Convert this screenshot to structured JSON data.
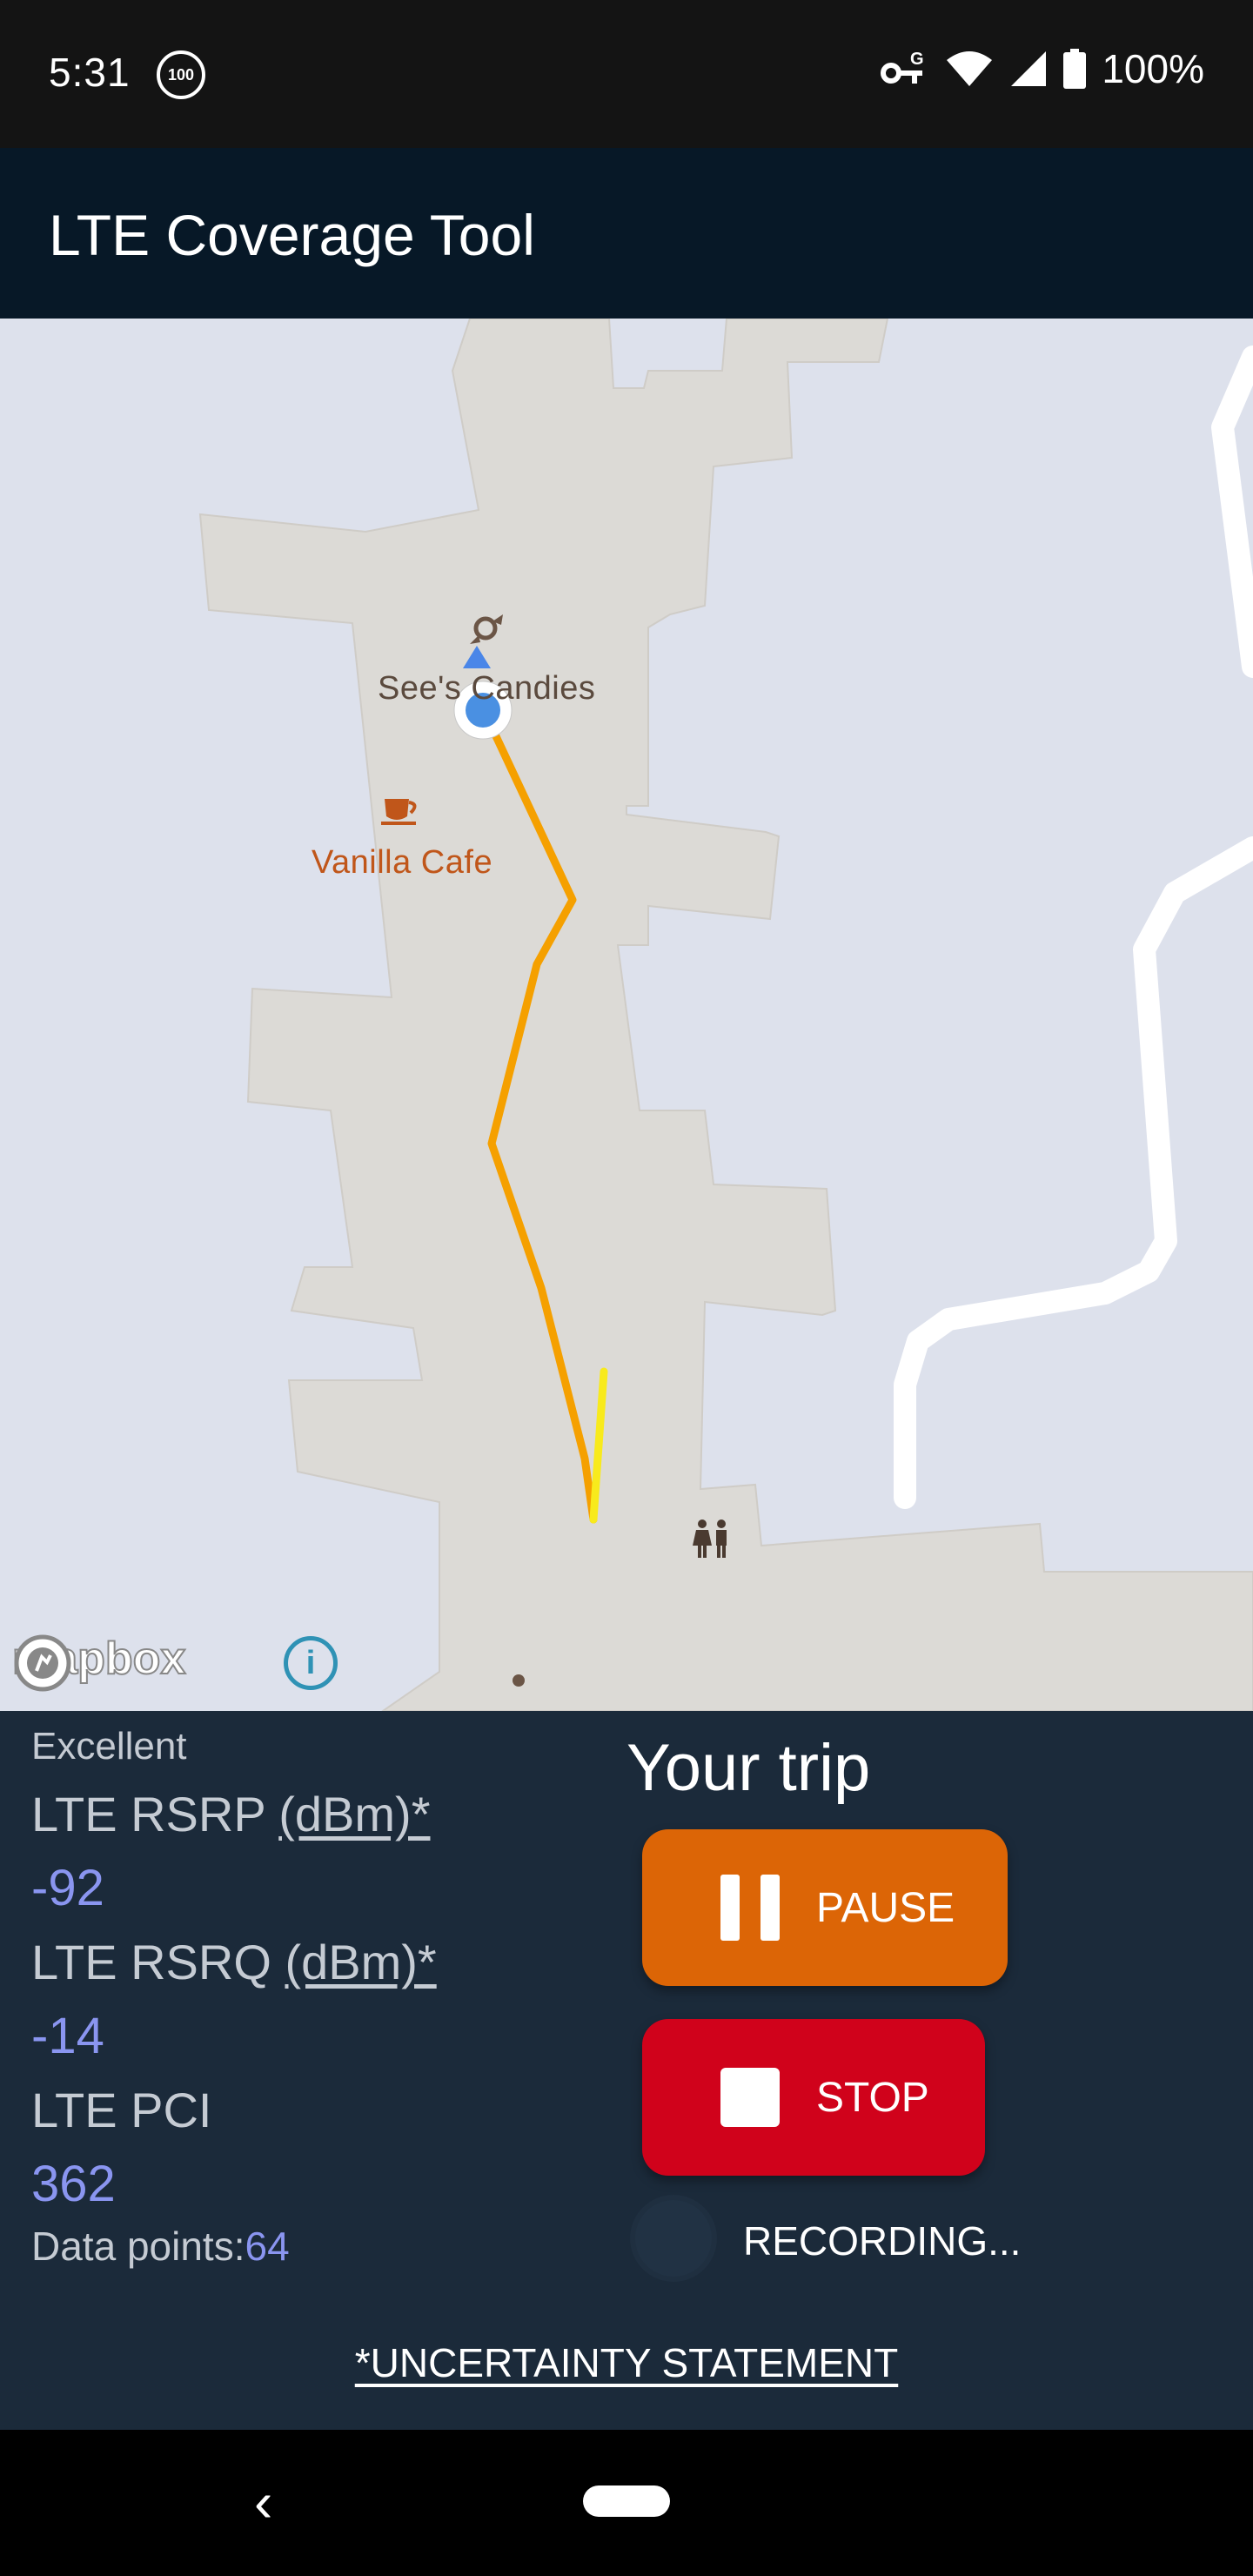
{
  "status_bar": {
    "time": "5:31",
    "notification_badge": "100",
    "battery_text": "100%",
    "icons": [
      "vpn-key-icon",
      "wifi-icon",
      "cellular-signal-icon",
      "battery-icon"
    ]
  },
  "app_bar": {
    "title": "LTE Coverage Tool"
  },
  "map": {
    "pois": {
      "sees": "See's Candies",
      "vanilla": "Vanilla Cafe"
    },
    "attribution": "mapbox",
    "info_glyph": "i",
    "track_colors": {
      "main": "#f5a000",
      "recent": "#f8ea1c"
    }
  },
  "panel": {
    "signal_quality": "Excellent",
    "metrics": [
      {
        "name": "LTE RSRP",
        "unit": "(dBm)*",
        "value": "-92"
      },
      {
        "name": "LTE RSRQ",
        "unit": "(dBm)*",
        "value": "-14"
      },
      {
        "name": "LTE PCI",
        "unit": "",
        "value": "362"
      }
    ],
    "data_points_label": "Data points:",
    "data_points_value": "64",
    "trip_title": "Your trip",
    "pause_label": "PAUSE",
    "stop_label": "STOP",
    "recording_label": "RECORDING...",
    "uncertainty_link": "*UNCERTAINTY STATEMENT",
    "colors": {
      "pause": "#dc6506",
      "stop": "#d0021b",
      "value_text": "#8a95f0"
    }
  },
  "nav_bar": {
    "back_glyph": "‹"
  }
}
